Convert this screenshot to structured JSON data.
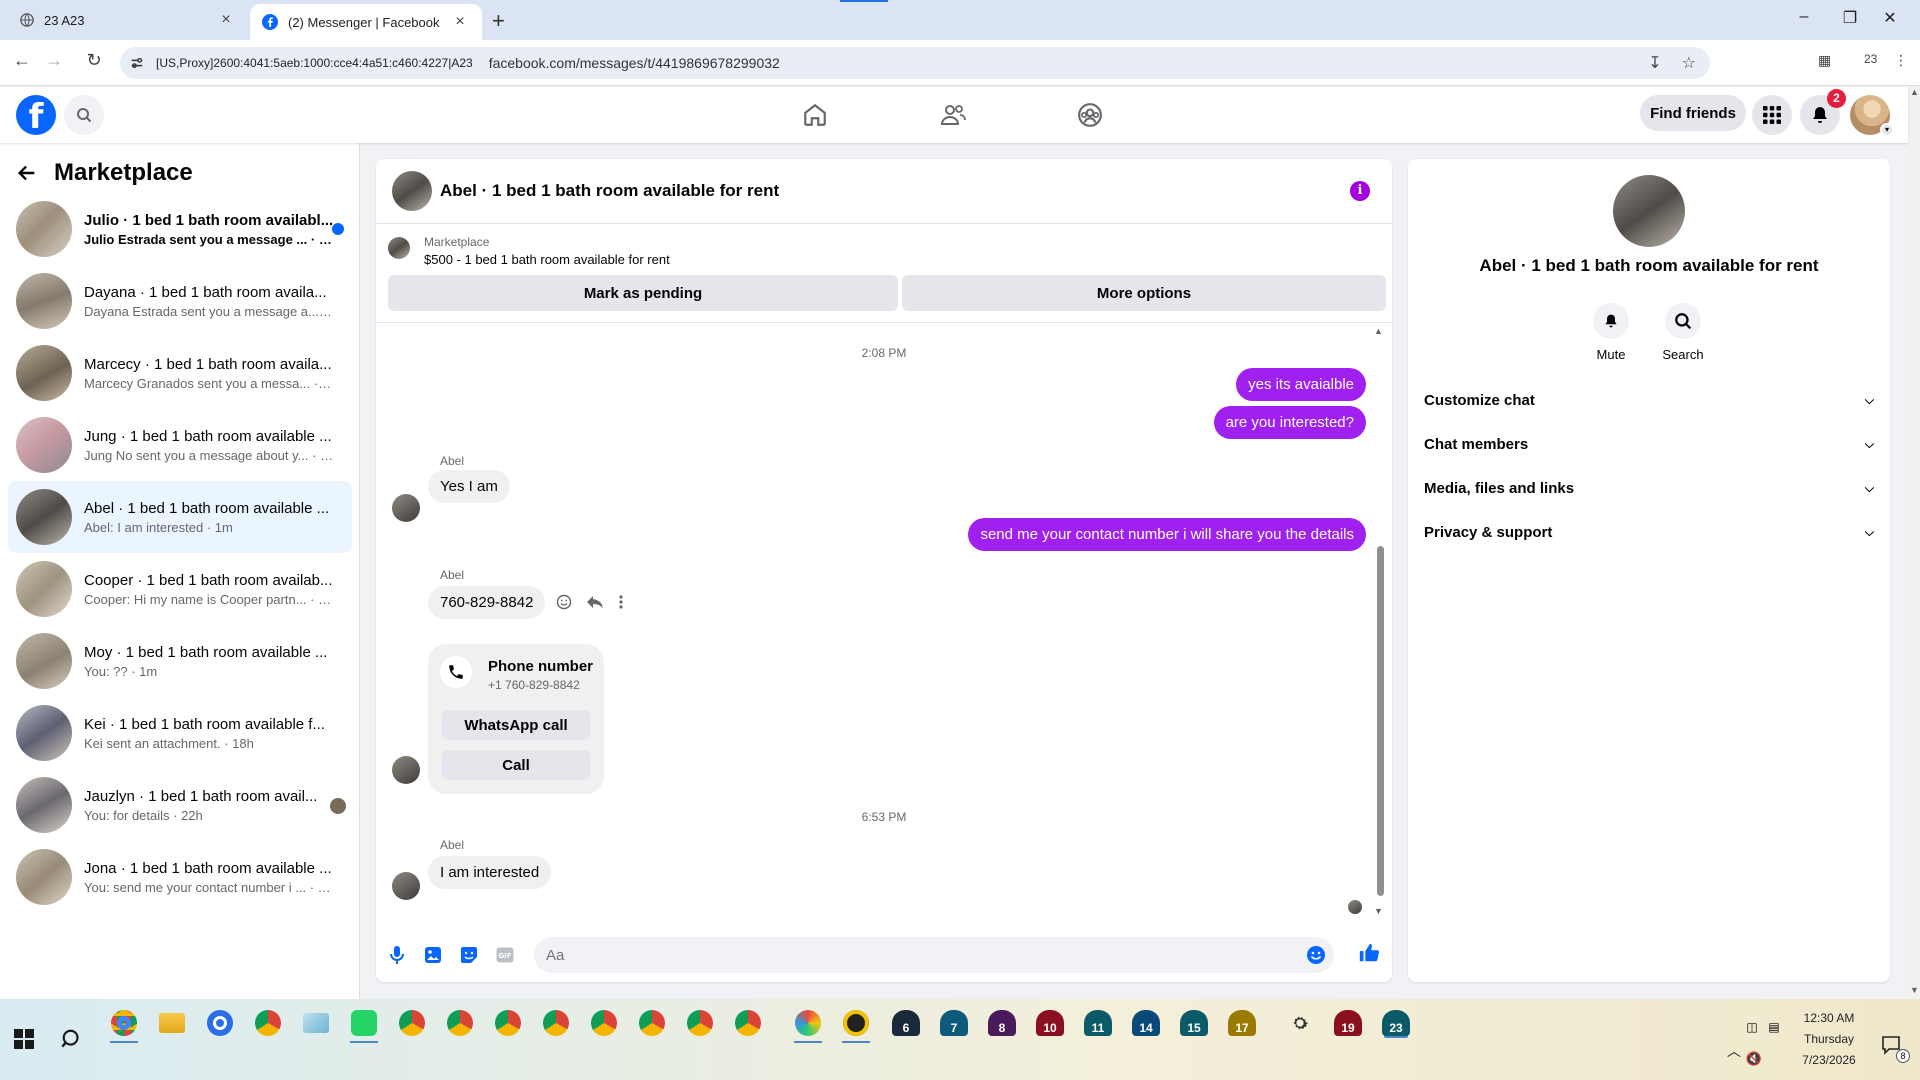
{
  "browser": {
    "tabs": [
      {
        "title": "23 A23",
        "active": false
      },
      {
        "title": "(2) Messenger | Facebook",
        "active": true
      }
    ],
    "proxy_label": "[US,Proxy]2600:4041:5aeb:1000:cce4:4a51:c460:4227|A23",
    "url": "facebook.com/messages/t/4419869678299032",
    "profile_count": "23"
  },
  "header": {
    "find_friends_label": "Find friends",
    "notification_count": "2"
  },
  "sidebar": {
    "title": "Marketplace",
    "conversations": [
      {
        "name": "Julio · 1 bed 1 bath room availabl...",
        "preview": "Julio Estrada sent you a message ... · 1m",
        "unread": true
      },
      {
        "name": "Dayana · 1 bed 1 bath room availa...",
        "preview": "Dayana Estrada sent you a message a... · 1m"
      },
      {
        "name": "Marcecy · 1 bed 1 bath room availa...",
        "preview": "Marcecy Granados sent you a messa... · 1m"
      },
      {
        "name": "Jung · 1 bed 1 bath room available ...",
        "preview": "Jung No sent you a message about y... · 1m"
      },
      {
        "name": "Abel · 1 bed 1 bath room available ...",
        "preview": "Abel: I am interested · 1m",
        "active": true
      },
      {
        "name": "Cooper · 1 bed 1 bath room availab...",
        "preview": "Cooper: Hi my name is Cooper partn... · 1m"
      },
      {
        "name": "Moy · 1 bed 1 bath room available ...",
        "preview": "You: ?? · 1m"
      },
      {
        "name": "Kei · 1 bed 1 bath room available f...",
        "preview": "Kei sent an attachment. · 18h"
      },
      {
        "name": "Jauzlyn · 1 bed 1 bath room avail...",
        "preview": "You: for details · 22h"
      },
      {
        "name": "Jona · 1 bed 1 bath room available ...",
        "preview": "You: send me your contact number i ... · 22h"
      }
    ]
  },
  "chat": {
    "title": "Abel · 1 bed 1 bath room available for rent",
    "marketplace_label": "Marketplace",
    "listing": "$500 - 1 bed 1 bath room available for rent",
    "mark_pending_label": "Mark as pending",
    "more_options_label": "More options",
    "timestamp1": "2:08 PM",
    "out1": "yes its avaialble",
    "out2": "are you interested?",
    "sender": "Abel",
    "in1": "Yes I am",
    "out3": "send me your contact number i will share you the details",
    "in2": "760-829-8842",
    "phone_card": {
      "title": "Phone number",
      "number": "+1 760-829-8842",
      "whatsapp_label": "WhatsApp call",
      "call_label": "Call"
    },
    "timestamp2": "6:53 PM",
    "in3": "I am interested",
    "composer_placeholder": "Aa",
    "accent_color": "#a020f0"
  },
  "info": {
    "name": "Abel · 1 bed 1 bath room available for rent",
    "mute_label": "Mute",
    "search_label": "Search",
    "sections": [
      "Customize chat",
      "Chat members",
      "Media, files and links",
      "Privacy & support"
    ]
  },
  "taskbar": {
    "time": "12:30 AM",
    "day": "Thursday",
    "date": "7/23/2026",
    "numbered_apps": [
      "6",
      "7",
      "8",
      "10",
      "11",
      "14",
      "15",
      "17",
      "19",
      "23"
    ],
    "notification_count": "8"
  }
}
